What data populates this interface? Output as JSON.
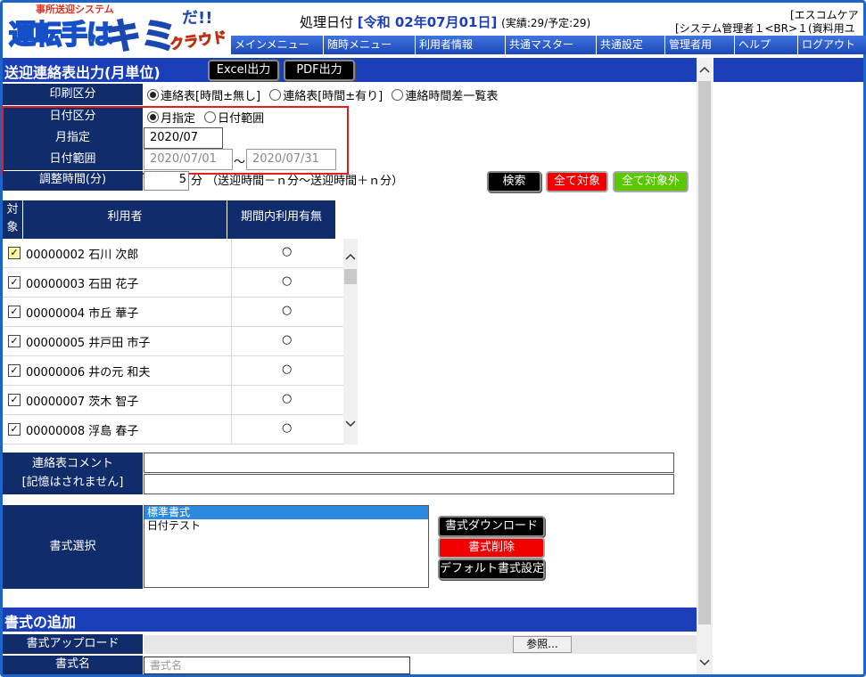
{
  "logo": {
    "subtitle": "事所送迎システム",
    "main": "運転手は",
    "kimi": "キミ",
    "da": "だ!!",
    "cloud": "クラウド"
  },
  "header": {
    "proc_label": "処理日付",
    "proc_date": "[令和 02年07月01日]",
    "proc_stats": "(実績:29/予定:29)",
    "company": "[エスコムケア",
    "user": "[システム管理者１<BR>１(資料用ユ"
  },
  "menu": [
    "メインメニュー",
    "随時メニュー",
    "利用者情報",
    "共通マスター",
    "共通設定",
    "管理者用",
    "ヘルプ",
    "ログアウト"
  ],
  "page": {
    "title": "送迎連絡表出力(月単位)",
    "excel_button": "Excel出力",
    "pdf_button": "PDF出力"
  },
  "form": {
    "print_type_label": "印刷区分",
    "print_options": [
      "連絡表[時間±無し]",
      "連絡表[時間±有り]",
      "連絡時間差一覧表"
    ],
    "date_type_label": "日付区分",
    "date_options": [
      "月指定",
      "日付範囲"
    ],
    "month_label": "月指定",
    "month_value": "2020/07",
    "range_label": "日付範囲",
    "range_from": "2020/07/01",
    "range_sep": "〜",
    "range_to": "2020/07/31",
    "adjust_label": "調整時間(分)",
    "adjust_value": "5",
    "adjust_note": "分 （送迎時間－ｎ分〜送迎時間＋ｎ分）"
  },
  "actions": {
    "search": "検索",
    "select_all": "全て対象",
    "deselect_all": "全て対象外"
  },
  "table": {
    "col_target": "対象",
    "col_user": "利用者",
    "col_usage": "期間内利用有無",
    "rows": [
      {
        "user": "00000002 石川 次郎",
        "usage": "○"
      },
      {
        "user": "00000003 石田 花子",
        "usage": "○"
      },
      {
        "user": "00000004 市丘 華子",
        "usage": "○"
      },
      {
        "user": "00000005 井戸田 市子",
        "usage": "○"
      },
      {
        "user": "00000006 井の元 和夫",
        "usage": "○"
      },
      {
        "user": "00000007 茨木 智子",
        "usage": "○"
      },
      {
        "user": "00000008 浮島 春子",
        "usage": "○"
      }
    ]
  },
  "comment": {
    "label_line1": "連絡表コメント",
    "label_line2": "[記憶はされません]"
  },
  "format": {
    "label": "書式選択",
    "options": [
      "標準書式",
      "日付テスト"
    ],
    "download": "書式ダウンロード",
    "delete": "書式削除",
    "default": "デフォルト書式設定"
  },
  "add_format": {
    "title": "書式の追加",
    "upload_label": "書式アップロード",
    "browse": "参照...",
    "name_label": "書式名",
    "name_placeholder": "書式名"
  }
}
